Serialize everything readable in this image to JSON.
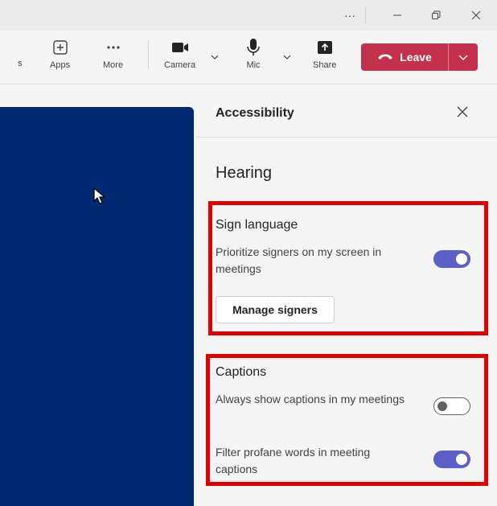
{
  "titlebar": {
    "more_label": "···",
    "icons": [
      "more-icon",
      "minimize-icon",
      "restore-icon",
      "close-icon"
    ]
  },
  "toolbar": {
    "partial_label": "s",
    "apps_label": "Apps",
    "more_label": "More",
    "camera_label": "Camera",
    "mic_label": "Mic",
    "share_label": "Share",
    "leave_label": "Leave",
    "leave_color": "#c4314b"
  },
  "panel": {
    "title": "Accessibility",
    "section_title": "Hearing",
    "sign_language": {
      "heading": "Sign language",
      "prioritize_text": "Prioritize signers on my screen in meetings",
      "prioritize_on": true,
      "manage_button": "Manage signers"
    },
    "captions": {
      "heading": "Captions",
      "always_show_text": "Always show captions in my meetings",
      "always_show_on": false,
      "filter_text": "Filter profane words in meeting captions",
      "filter_on": true
    }
  },
  "colors": {
    "accent": "#5b5fc7",
    "stage": "#002a72",
    "highlight": "#e00000"
  }
}
